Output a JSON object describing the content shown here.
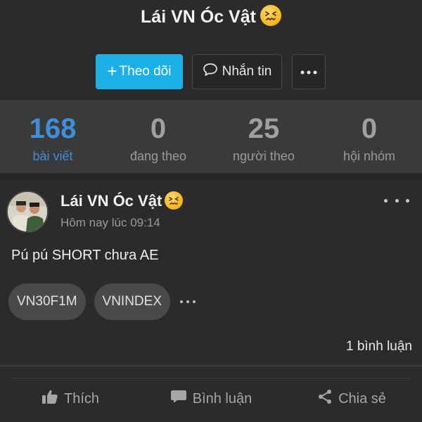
{
  "profile": {
    "name": "Lái VN Óc Vật",
    "follow_label": "Theo dõi",
    "message_label": "Nhắn tin"
  },
  "stats": [
    {
      "value": "168",
      "label": "bài viết",
      "active": true
    },
    {
      "value": "0",
      "label": "đang theo",
      "active": false
    },
    {
      "value": "25",
      "label": "người theo",
      "active": false
    },
    {
      "value": "0",
      "label": "hội nhóm",
      "active": false
    }
  ],
  "post": {
    "author": "Lái VN Óc Vật",
    "time": "Hôm nay lúc 09:14",
    "text": "Pú pú SHORT chưa AE",
    "tags": [
      "VN30F1M",
      "VNINDEX"
    ],
    "comment_count": "1 bình luận",
    "actions": {
      "like": "Thích",
      "comment": "Bình luận",
      "share": "Chia sẻ"
    }
  },
  "colors": {
    "accent": "#1db0e6",
    "active_stat": "#3d8fdb",
    "background": "#262626"
  },
  "icons": [
    "confounded-emoji-icon",
    "plus-icon",
    "chat-bubble-icon",
    "more-horizontal-icon",
    "thumbs-up-icon",
    "comment-icon",
    "share-icon"
  ]
}
